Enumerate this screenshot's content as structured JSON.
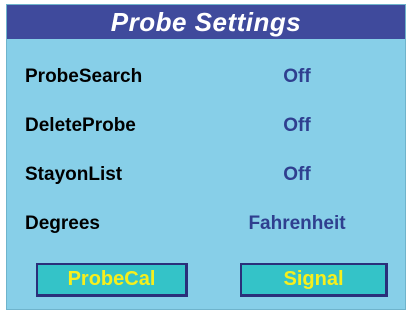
{
  "title": "Probe Settings",
  "settings": [
    {
      "label": "ProbeSearch",
      "value": "Off"
    },
    {
      "label": "DeleteProbe",
      "value": "Off"
    },
    {
      "label": "StayonList",
      "value": "Off"
    },
    {
      "label": "Degrees",
      "value": "Fahrenheit"
    }
  ],
  "buttons": {
    "probe_cal": "ProbeCal",
    "signal": "Signal"
  },
  "colors": {
    "panel_bg": "#87cfe8",
    "title_bg": "#3f4a9c",
    "value_text": "#2f3f8f",
    "button_bg": "#34c3c8",
    "button_text": "#f7ef1c"
  }
}
